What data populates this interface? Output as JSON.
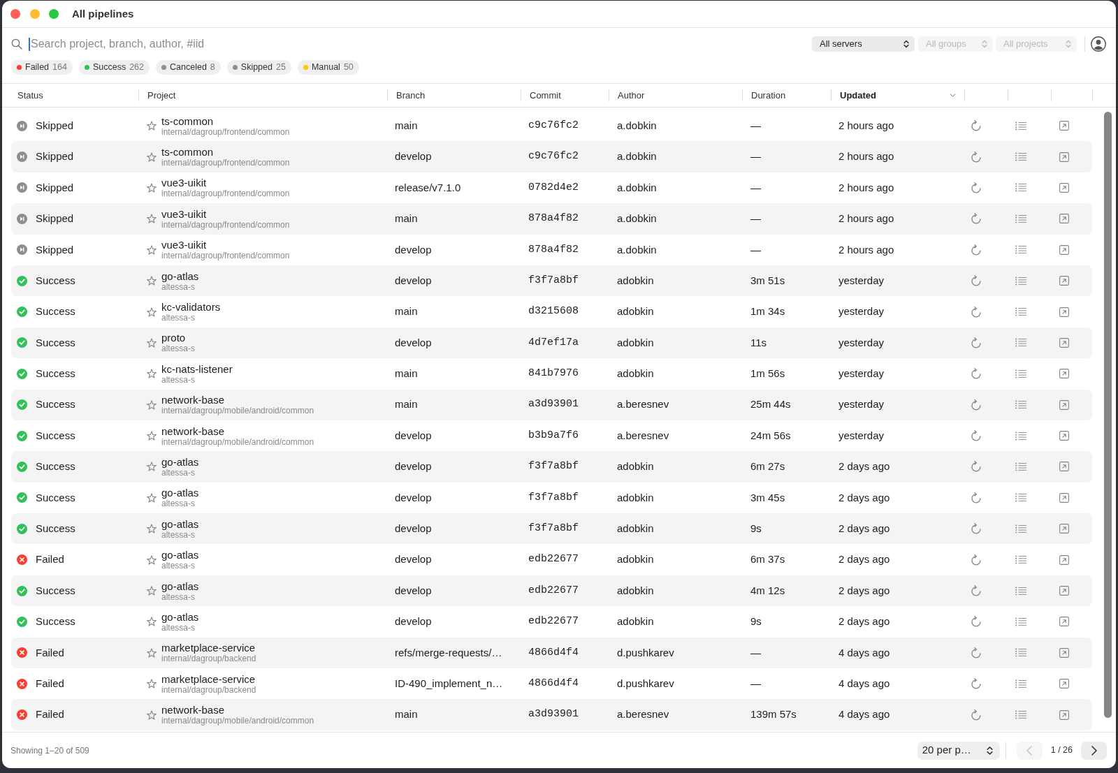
{
  "window": {
    "title": "All pipelines"
  },
  "search": {
    "placeholder": "Search project, branch, author, #iid",
    "focused": true
  },
  "selects": [
    {
      "value": "All servers",
      "disabled": false
    },
    {
      "value": "All groups",
      "disabled": true
    },
    {
      "value": "All projects",
      "disabled": true
    }
  ],
  "filters": [
    {
      "label": "Failed",
      "count": "164",
      "color": "#ff3b30"
    },
    {
      "label": "Success",
      "count": "262",
      "color": "#30c158"
    },
    {
      "label": "Canceled",
      "count": "8",
      "color": "#8e8e8e"
    },
    {
      "label": "Skipped",
      "count": "25",
      "color": "#8e8e8e"
    },
    {
      "label": "Manual",
      "count": "50",
      "color": "#ffc800"
    }
  ],
  "table": {
    "columns": [
      {
        "label": "Status",
        "sorted": false
      },
      {
        "label": "Project",
        "sorted": false
      },
      {
        "label": "Branch",
        "sorted": false
      },
      {
        "label": "Commit",
        "sorted": false
      },
      {
        "label": "Author",
        "sorted": false
      },
      {
        "label": "Duration",
        "sorted": false
      },
      {
        "label": "Updated",
        "sorted": true
      }
    ],
    "rows": [
      {
        "kind": "skipped",
        "status": "Skipped",
        "starred": false,
        "project": "ts-common",
        "path": "internal/dagroup/frontend/common",
        "branch": "main",
        "commit": "c9c76fc2",
        "author": "a.dobkin",
        "duration": "—",
        "updated": "2 hours ago"
      },
      {
        "kind": "skipped",
        "status": "Skipped",
        "starred": false,
        "project": "ts-common",
        "path": "internal/dagroup/frontend/common",
        "branch": "develop",
        "commit": "c9c76fc2",
        "author": "a.dobkin",
        "duration": "—",
        "updated": "2 hours ago"
      },
      {
        "kind": "skipped",
        "status": "Skipped",
        "starred": false,
        "project": "vue3-uikit",
        "path": "internal/dagroup/frontend/common",
        "branch": "release/v7.1.0",
        "commit": "0782d4e2",
        "author": "a.dobkin",
        "duration": "—",
        "updated": "2 hours ago"
      },
      {
        "kind": "skipped",
        "status": "Skipped",
        "starred": false,
        "project": "vue3-uikit",
        "path": "internal/dagroup/frontend/common",
        "branch": "main",
        "commit": "878a4f82",
        "author": "a.dobkin",
        "duration": "—",
        "updated": "2 hours ago"
      },
      {
        "kind": "skipped",
        "status": "Skipped",
        "starred": false,
        "project": "vue3-uikit",
        "path": "internal/dagroup/frontend/common",
        "branch": "develop",
        "commit": "878a4f82",
        "author": "a.dobkin",
        "duration": "—",
        "updated": "2 hours ago"
      },
      {
        "kind": "success",
        "status": "Success",
        "starred": false,
        "project": "go-atlas",
        "path": "altessa-s",
        "branch": "develop",
        "commit": "f3f7a8bf",
        "author": "adobkin",
        "duration": "3m 51s",
        "updated": "yesterday"
      },
      {
        "kind": "success",
        "status": "Success",
        "starred": false,
        "project": "kc-validators",
        "path": "altessa-s",
        "branch": "main",
        "commit": "d3215608",
        "author": "adobkin",
        "duration": "1m 34s",
        "updated": "yesterday"
      },
      {
        "kind": "success",
        "status": "Success",
        "starred": false,
        "project": "proto",
        "path": "altessa-s",
        "branch": "develop",
        "commit": "4d7ef17a",
        "author": "adobkin",
        "duration": "11s",
        "updated": "yesterday"
      },
      {
        "kind": "success",
        "status": "Success",
        "starred": false,
        "project": "kc-nats-listener",
        "path": "altessa-s",
        "branch": "main",
        "commit": "841b7976",
        "author": "adobkin",
        "duration": "1m 56s",
        "updated": "yesterday"
      },
      {
        "kind": "success",
        "status": "Success",
        "starred": false,
        "project": "network-base",
        "path": "internal/dagroup/mobile/android/common",
        "branch": "main",
        "commit": "a3d93901",
        "author": "a.beresnev",
        "duration": "25m 44s",
        "updated": "yesterday"
      },
      {
        "kind": "success",
        "status": "Success",
        "starred": false,
        "project": "network-base",
        "path": "internal/dagroup/mobile/android/common",
        "branch": "develop",
        "commit": "b3b9a7f6",
        "author": "a.beresnev",
        "duration": "24m 56s",
        "updated": "yesterday"
      },
      {
        "kind": "success",
        "status": "Success",
        "starred": false,
        "project": "go-atlas",
        "path": "altessa-s",
        "branch": "develop",
        "commit": "f3f7a8bf",
        "author": "adobkin",
        "duration": "6m 27s",
        "updated": "2 days ago"
      },
      {
        "kind": "success",
        "status": "Success",
        "starred": false,
        "project": "go-atlas",
        "path": "altessa-s",
        "branch": "develop",
        "commit": "f3f7a8bf",
        "author": "adobkin",
        "duration": "3m 45s",
        "updated": "2 days ago"
      },
      {
        "kind": "success",
        "status": "Success",
        "starred": false,
        "project": "go-atlas",
        "path": "altessa-s",
        "branch": "develop",
        "commit": "f3f7a8bf",
        "author": "adobkin",
        "duration": "9s",
        "updated": "2 days ago"
      },
      {
        "kind": "failed",
        "status": "Failed",
        "starred": false,
        "project": "go-atlas",
        "path": "altessa-s",
        "branch": "develop",
        "commit": "edb22677",
        "author": "adobkin",
        "duration": "6m 37s",
        "updated": "2 days ago"
      },
      {
        "kind": "success",
        "status": "Success",
        "starred": false,
        "project": "go-atlas",
        "path": "altessa-s",
        "branch": "develop",
        "commit": "edb22677",
        "author": "adobkin",
        "duration": "4m 12s",
        "updated": "2 days ago"
      },
      {
        "kind": "success",
        "status": "Success",
        "starred": false,
        "project": "go-atlas",
        "path": "altessa-s",
        "branch": "develop",
        "commit": "edb22677",
        "author": "adobkin",
        "duration": "9s",
        "updated": "2 days ago"
      },
      {
        "kind": "failed",
        "status": "Failed",
        "starred": false,
        "project": "marketplace-service",
        "path": "internal/dagroup/backend",
        "branch": "refs/merge-requests/…",
        "commit": "4866d4f4",
        "author": "d.pushkarev",
        "duration": "—",
        "updated": "4 days ago"
      },
      {
        "kind": "failed",
        "status": "Failed",
        "starred": false,
        "project": "marketplace-service",
        "path": "internal/dagroup/backend",
        "branch": "ID-490_implement_n…",
        "commit": "4866d4f4",
        "author": "d.pushkarev",
        "duration": "—",
        "updated": "4 days ago"
      },
      {
        "kind": "failed",
        "status": "Failed",
        "starred": false,
        "project": "network-base",
        "path": "internal/dagroup/mobile/android/common",
        "branch": "main",
        "commit": "a3d93901",
        "author": "a.beresnev",
        "duration": "139m 57s",
        "updated": "4 days ago"
      }
    ]
  },
  "footer": {
    "summary": "Showing 1–20 of 509",
    "per_page": "20 per p…",
    "prev": {
      "disabled": true
    },
    "page": "1 / 26",
    "next": {
      "disabled": false
    }
  }
}
